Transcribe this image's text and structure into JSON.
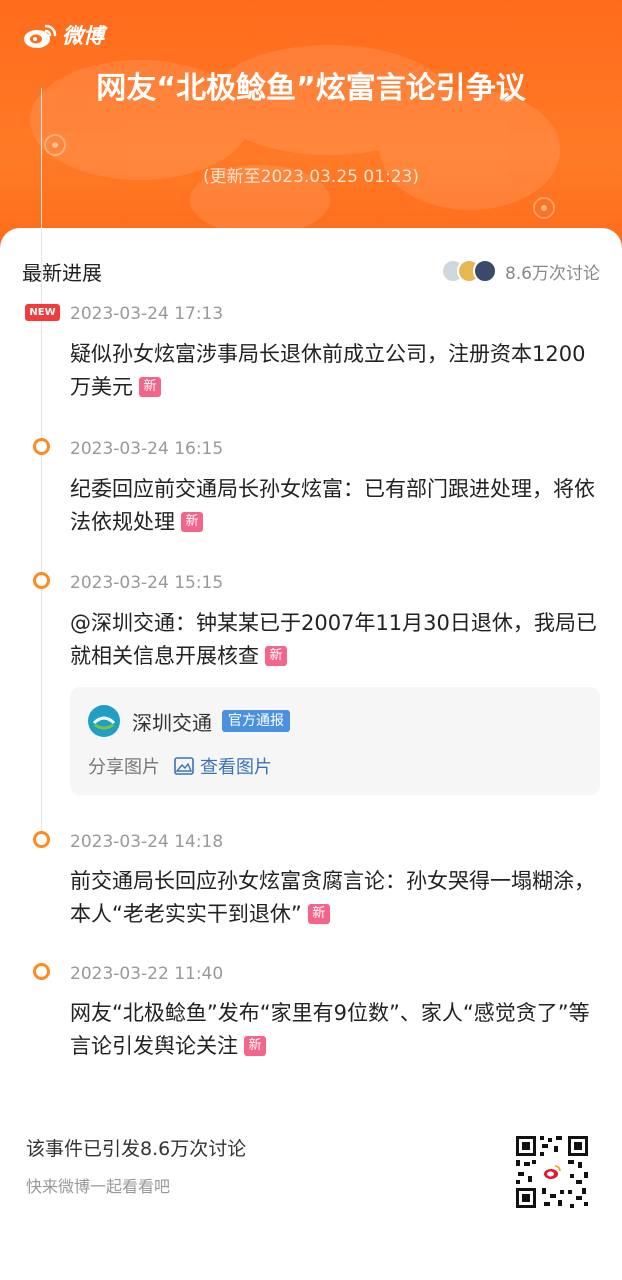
{
  "brand": {
    "name": "微博"
  },
  "header": {
    "headline": "网友“北极鲶鱼”炫富言论引争议",
    "update_text": "(更新至2023.03.25 01:23)"
  },
  "card": {
    "title": "最新进展",
    "discussion_count": "8.6万次讨论"
  },
  "new_label": "新",
  "new_badge": "NEW",
  "timeline": [
    {
      "time": "2023-03-24 17:13",
      "text": "疑似孙女炫富涉事局长退休前成立公司，注册资本1200万美元"
    },
    {
      "time": "2023-03-24 16:15",
      "text": "纪委回应前交通局长孙女炫富：已有部门跟进处理，将依法依规处理"
    },
    {
      "time": "2023-03-24 15:15",
      "text": "@深圳交通：钟某某已于2007年11月30日退休，我局已就相关信息开展核查"
    },
    {
      "time": "2023-03-24 14:18",
      "text": "前交通局长回应孙女炫富贪腐言论：孙女哭得一塌糊涂，本人“老老实实干到退休”"
    },
    {
      "time": "2023-03-22 11:40",
      "text": "网友“北极鲶鱼”发布“家里有9位数”、家人“感觉贪了”等言论引发舆论关注"
    }
  ],
  "share_card": {
    "account_name": "深圳交通",
    "tag": "官方通报",
    "share_label": "分享图片",
    "view_label": "查看图片"
  },
  "footer": {
    "title": "该事件已引发8.6万次讨论",
    "subtitle": "快来微博一起看看吧"
  },
  "colors": {
    "brand_orange": "#ff6b1c",
    "dot_orange": "#ff8a1f",
    "new_red": "#f03c3c",
    "xin_pink": "#f3658a",
    "link_blue": "#3a73b8"
  }
}
